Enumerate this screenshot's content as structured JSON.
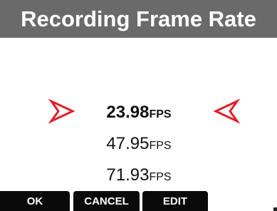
{
  "header": {
    "title": "Recording Frame Rate"
  },
  "accent_color": "#e0202a",
  "options": [
    {
      "value": "23.98",
      "unit": "FPS",
      "selected": true
    },
    {
      "value": "47.95",
      "unit": "FPS",
      "selected": false
    },
    {
      "value": "71.93",
      "unit": "FPS",
      "selected": false
    }
  ],
  "softkeys": {
    "ok": "OK",
    "cancel": "CANCEL",
    "edit": "EDIT"
  },
  "icons": {
    "left": "selection-arrow-right-icon",
    "right": "selection-arrow-left-icon"
  }
}
